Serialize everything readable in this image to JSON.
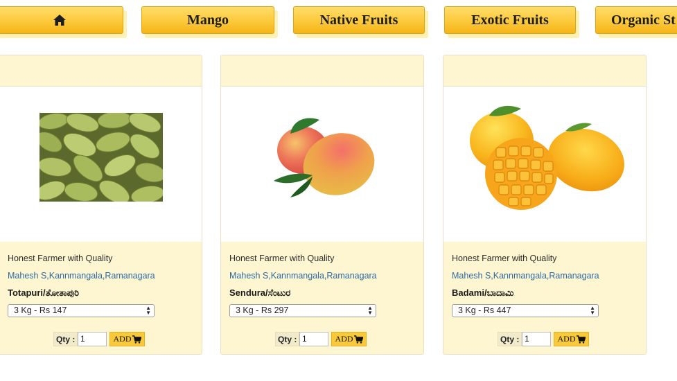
{
  "nav": {
    "home_icon": "home-icon",
    "items": [
      {
        "label": "Mango"
      },
      {
        "label": "Native Fruits"
      },
      {
        "label": "Exotic Fruits"
      },
      {
        "label": "Organic St"
      }
    ]
  },
  "colors": {
    "nav_gradient_top": "#ffde6a",
    "nav_gradient_bottom": "#f5b318",
    "card_panel": "#fdf6d1",
    "link_blue": "#2d6aa6",
    "add_button": "#f8c93a"
  },
  "products": [
    {
      "tagline": "Honest Farmer with Quality",
      "farmer": "Mahesh S,Kannmangala,Ramanagara",
      "name": "Totapuri/ತೋತಾಪುರಿ",
      "variant": "3 Kg - Rs 147",
      "qty_label": "Qty :",
      "qty_value": "1",
      "add_label": "ADD",
      "image": "green-totapuri-mangoes-photo"
    },
    {
      "tagline": "Honest Farmer with Quality",
      "farmer": "Mahesh S,Kannmangala,Ramanagara",
      "name": "Sendura/ಸೆಂಟುರ",
      "variant": "3 Kg - Rs 297",
      "qty_label": "Qty :",
      "qty_value": "1",
      "add_label": "ADD",
      "image": "red-sendura-mangoes-photo"
    },
    {
      "tagline": "Honest Farmer with Quality",
      "farmer": "Mahesh S,Kannmangala,Ramanagara",
      "name": "Badami/ಬಾದಾಮಿ",
      "variant": "3 Kg - Rs 447",
      "qty_label": "Qty :",
      "qty_value": "1",
      "add_label": "ADD",
      "image": "yellow-badami-mangoes-photo"
    }
  ]
}
